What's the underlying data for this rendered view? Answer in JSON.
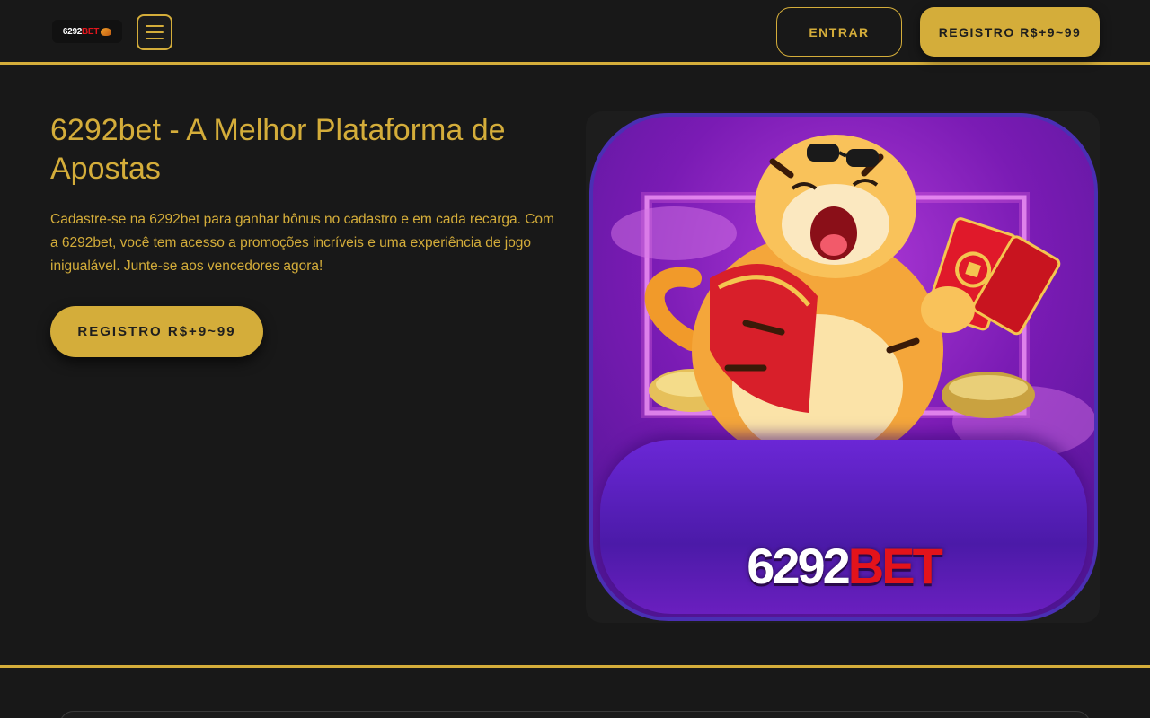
{
  "header": {
    "logo": {
      "number": "6292",
      "brand": "BET"
    },
    "menu_icon": "hamburger-menu-icon",
    "login_label": "ENTRAR",
    "register_label": "REGISTRO R$+9~99"
  },
  "hero": {
    "title": "6292bet - A Melhor Plataforma de Apostas",
    "description": "Cadastre-se na 6292bet para ganhar bônus no cadastro e em cada recarga. Com a 6292bet, você tem acesso a promoções incríveis e uma experiência de jogo inigualável. Junte-se aos vencedores agora!",
    "cta_label": "REGISTRO R$+9~99"
  },
  "promo_card": {
    "brand_number": "6292",
    "brand_suffix": "BET",
    "image": "fortune-tiger-illustration"
  },
  "colors": {
    "background": "#181818",
    "accent_gold": "#d4ad3a",
    "brand_red": "#e3131b",
    "card_purple": "#7a1bb4"
  }
}
